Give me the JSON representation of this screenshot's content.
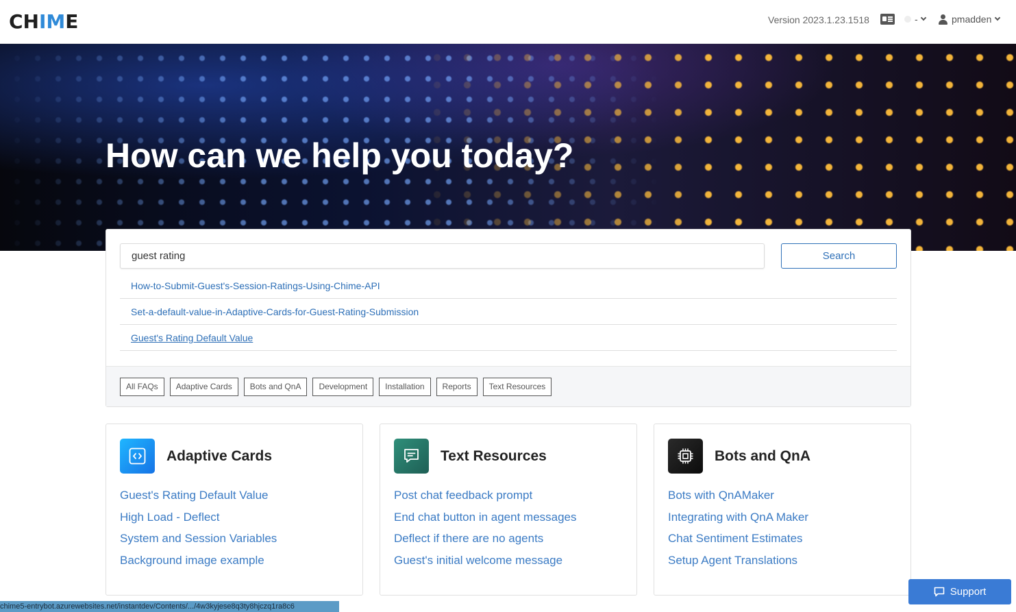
{
  "header": {
    "logo_pre": "CH",
    "logo_accent": "IM",
    "logo_post": "E",
    "version": "Version 2023.1.23.1518",
    "status_value": "-",
    "username": "pmadden"
  },
  "hero": {
    "title": "How can we help you today?"
  },
  "search": {
    "value": "guest rating",
    "button_label": "Search",
    "results": [
      "How-to-Submit-Guest's-Session-Ratings-Using-Chime-API",
      "Set-a-default-value-in-Adaptive-Cards-for-Guest-Rating-Submission",
      "Guest's Rating Default Value"
    ]
  },
  "filters": [
    "All FAQs",
    "Adaptive Cards",
    "Bots and QnA",
    "Development",
    "Installation",
    "Reports",
    "Text Resources"
  ],
  "cards": [
    {
      "title": "Adaptive Cards",
      "icon": "code-brackets-icon",
      "links": [
        "Guest's Rating Default Value",
        "High Load - Deflect",
        "System and Session Variables",
        "Background image example"
      ]
    },
    {
      "title": "Text Resources",
      "icon": "chat-bubble-icon",
      "links": [
        "Post chat feedback prompt",
        "End chat button in agent messages",
        "Deflect if there are no agents",
        "Guest's initial welcome message"
      ]
    },
    {
      "title": "Bots and QnA",
      "icon": "cpu-chip-icon",
      "links": [
        "Bots with QnAMaker",
        "Integrating with QnA Maker",
        "Chat Sentiment Estimates",
        "Setup Agent Translations"
      ]
    }
  ],
  "support": {
    "label": "Support"
  },
  "status_bar": {
    "url": "chime5-entrybot.azurewebsites.net/instantdev/Contents/.../4w3kyjese8q3ty8hjczq1ra8c6"
  },
  "colors": {
    "link": "#2d6fb7",
    "accent": "#2f8ad8",
    "support": "#3a7bd5"
  }
}
